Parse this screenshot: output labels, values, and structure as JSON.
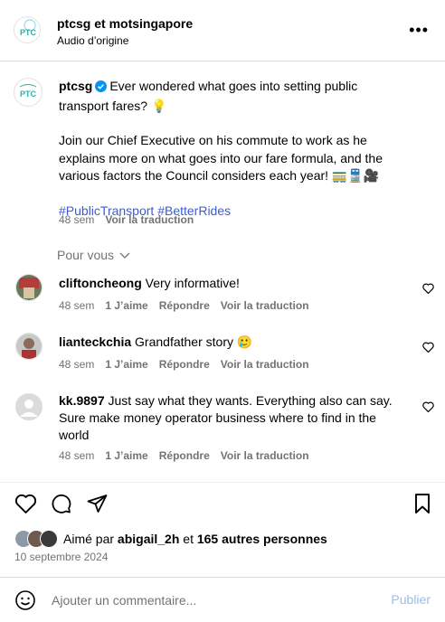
{
  "header": {
    "title": "ptcsg et motsingapore",
    "subtitle": "Audio d’origine",
    "more_label": "•••"
  },
  "post": {
    "username": "ptcsg",
    "caption_line1": "Ever wondered what goes into setting public transport fares? 💡",
    "caption_line2": "Join our Chief Executive on his commute to work as he explains more on what goes into our fare formula, and the various factors the Council considers each year! 🚃🚆🎥",
    "hashtags": "#PublicTransport #BetterRides",
    "age": "48 sem",
    "translate": "Voir la traduction"
  },
  "section_label": "Pour vous",
  "comments": [
    {
      "username": "cliftoncheong",
      "text": "Very informative!",
      "age": "48 sem",
      "likes": "1 J’aime",
      "reply": "Répondre",
      "translate": "Voir la traduction"
    },
    {
      "username": "lianteckchia",
      "text": "Grandfather story 🥲",
      "age": "48 sem",
      "likes": "1 J’aime",
      "reply": "Répondre",
      "translate": "Voir la traduction"
    },
    {
      "username": "kk.9897",
      "text": "Just say what they wants. Everything also can say. Sure make money operator business where to find in the world",
      "age": "48 sem",
      "likes": "1 J’aime",
      "reply": "Répondre",
      "translate": "Voir la traduction"
    }
  ],
  "likes_bar": {
    "prefix": "Aimé par",
    "user": "abigail_2h",
    "conj": "et",
    "others": "165 autres personnes"
  },
  "date": "10 septembre 2024",
  "comment_box": {
    "placeholder": "Ajouter un commentaire...",
    "post_label": "Publier"
  },
  "colors": {
    "link": "#3b5bdb",
    "muted": "#737373",
    "brand_teal": "#2bb3a3",
    "post_button": "#9bbcf0"
  }
}
